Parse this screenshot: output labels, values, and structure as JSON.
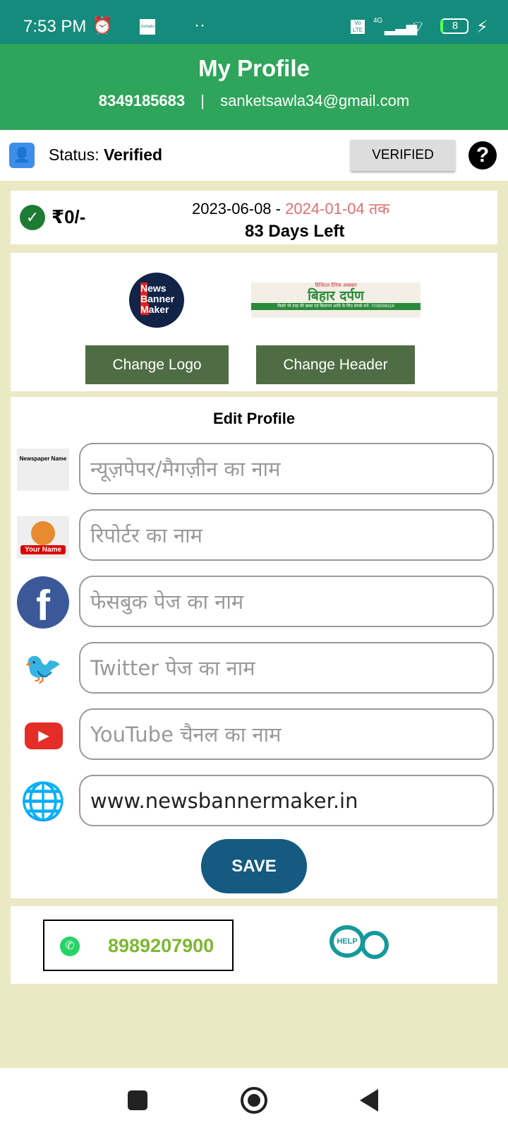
{
  "status_bar": {
    "time": "7:53 PM",
    "network": "4G",
    "battery": "8",
    "volte": "Vo LTE",
    "app_icon_text": "zomato"
  },
  "header": {
    "title": "My Profile",
    "phone": "8349185683",
    "separator": "|",
    "email": "sanketsawla34@gmail.com"
  },
  "status": {
    "label": "Status: ",
    "value": "Verified",
    "badge": "VERIFIED",
    "help": "?"
  },
  "plan": {
    "amount": "₹0/-",
    "start_date": "2023-06-08",
    "dash": " - ",
    "end_date": "2024-01-04 तक",
    "days_left": "83 Days Left"
  },
  "branding": {
    "logo_text": [
      "News",
      "Banner",
      "Maker"
    ],
    "header_title": "बिहार दर्पण",
    "header_subtitle": "डिजिटल दैनिक अखबार",
    "header_strip": "किसी भी तरह की खबर एवं विज्ञापन आदि के लिए संपर्क करें- 7209306116",
    "change_logo": "Change Logo",
    "change_header": "Change Header"
  },
  "form": {
    "title": "Edit Profile",
    "newspaper_icon_text": "Newspaper Name",
    "reporter_icon_text": "Your Name",
    "fields": [
      {
        "placeholder": "न्यूज़पेपर/मैगज़ीन  का नाम",
        "value": ""
      },
      {
        "placeholder": "रिपोर्टर का नाम",
        "value": ""
      },
      {
        "placeholder": "फेसबुक पेज का नाम",
        "value": ""
      },
      {
        "placeholder": "Twitter पेज का नाम",
        "value": ""
      },
      {
        "placeholder": "YouTube चैनल का नाम",
        "value": ""
      },
      {
        "placeholder": "",
        "value": "www.newsbannermaker.in"
      }
    ],
    "save": "SAVE"
  },
  "contact": {
    "whatsapp": "8989207900",
    "help_icon_text": "HELP"
  },
  "colors": {
    "status_bar": "#148b7c",
    "header": "#2ea55a",
    "background": "#ebe8c4",
    "button": "#4f6d44",
    "save": "#155a80",
    "end_date": "#e07070",
    "phone": "#7cb82f"
  }
}
